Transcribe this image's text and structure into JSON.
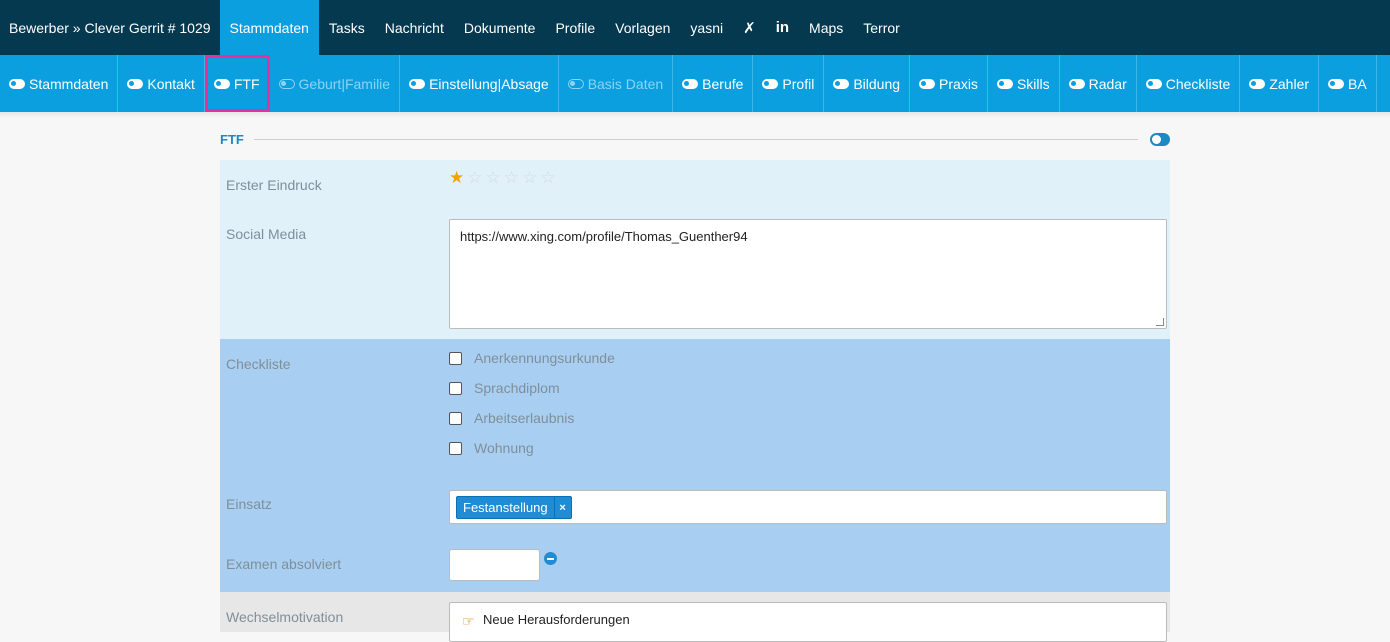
{
  "topbar": {
    "brand": "Bewerber » Clever Gerrit # 1029",
    "items": [
      {
        "label": "Stammdaten",
        "active": true
      },
      {
        "label": "Tasks"
      },
      {
        "label": "Nachricht"
      },
      {
        "label": "Dokumente"
      },
      {
        "label": "Profile"
      },
      {
        "label": "Vorlagen"
      },
      {
        "label": "yasni"
      }
    ],
    "icon_xing": "✗",
    "icon_linkedin": "in",
    "items2": [
      {
        "label": "Maps"
      },
      {
        "label": "Terror"
      }
    ]
  },
  "subnav": {
    "items": [
      {
        "label": "Stammdaten"
      },
      {
        "label": "Kontakt"
      },
      {
        "label": "FTF"
      },
      {
        "label": "Geburt|Familie"
      },
      {
        "label": "Einstellung|Absage"
      },
      {
        "label": "Basis Daten"
      },
      {
        "label": "Berufe"
      },
      {
        "label": "Profil"
      },
      {
        "label": "Bildung"
      },
      {
        "label": "Praxis"
      },
      {
        "label": "Skills"
      },
      {
        "label": "Radar"
      },
      {
        "label": "Checkliste"
      },
      {
        "label": "Zahler"
      },
      {
        "label": "BA"
      }
    ]
  },
  "section": {
    "title": "FTF"
  },
  "form": {
    "erster_eindruck": {
      "label": "Erster Eindruck",
      "rating": 1,
      "max": 6
    },
    "social_media": {
      "label": "Social Media",
      "value": "https://www.xing.com/profile/Thomas_Guenther94"
    },
    "checkliste": {
      "label": "Checkliste",
      "options": [
        "Anerkennungsurkunde",
        "Sprachdiplom",
        "Arbeitserlaubnis",
        "Wohnung"
      ]
    },
    "einsatz": {
      "label": "Einsatz",
      "tag": "Festanstellung",
      "remove": "×"
    },
    "examen": {
      "label": "Examen absolviert",
      "value": ""
    },
    "wechselmotivation": {
      "label": "Wechselmotivation",
      "value": "Neue Herausforderungen"
    }
  },
  "colors": {
    "topbar": "#05394f",
    "subbar": "#0b9fdf",
    "highlight": "#e3319f",
    "star": "#f0a400"
  }
}
